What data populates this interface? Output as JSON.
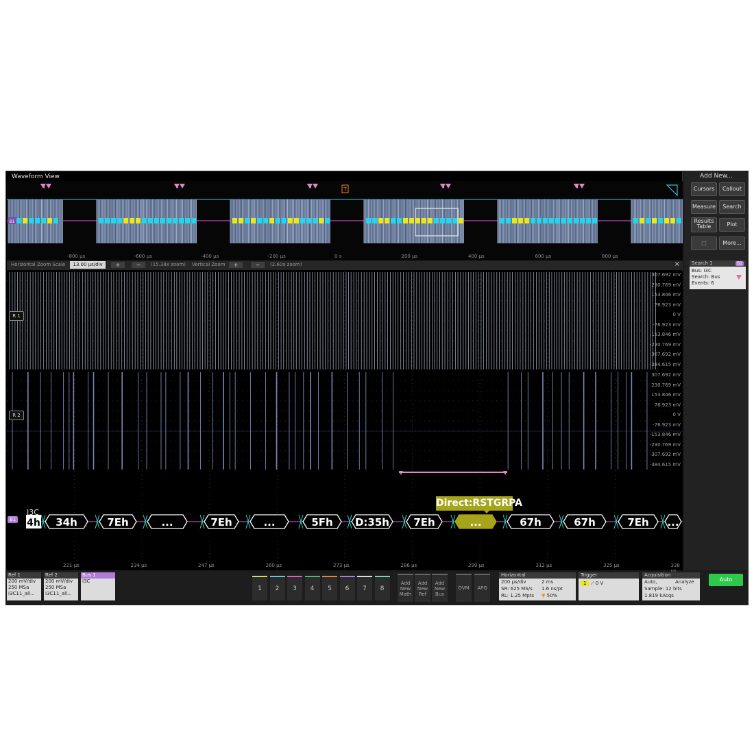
{
  "waveform_view": {
    "title": "Waveform View",
    "overview_ticks": [
      "-800 µs",
      "-600 µs",
      "-400 µs",
      "-200 µs",
      "0 s",
      "200 µs",
      "400 µs",
      "600 µs",
      "800 µs"
    ],
    "bus_marker": "B1",
    "trigger_marker": "T"
  },
  "zoom_bar": {
    "horizontal_label": "Horizontal Zoom Scale",
    "horizontal_value": "13.00 µs/div",
    "horizontal_zoom": "(15.38x zoom)",
    "vertical_label": "Vertical Zoom",
    "vertical_zoom": "(2.60x zoom)",
    "plus": "+",
    "minus": "−",
    "close": "×"
  },
  "ref1": {
    "label": "R 1",
    "yticks": [
      "307.692 mV",
      "230.769 mV",
      "153.846 mV",
      "76.923 mV",
      "0 V",
      "-76.923 mV",
      "-153.846 mV",
      "-230.769 mV",
      "-307.692 mV",
      "-384.615 mV"
    ]
  },
  "ref2": {
    "label": "R 2",
    "yticks": [
      "307.692 mV",
      "230.769 mV",
      "153.846 mV",
      "76.923 mV",
      "0 V",
      "-76.923 mV",
      "-153.846 mV",
      "-230.769 mV",
      "-307.692 mV",
      "-384.615 mV"
    ]
  },
  "bus": {
    "label": "B1",
    "protocol": "I3C",
    "partial": "4h",
    "packets": [
      "34h",
      "7Eh",
      "...",
      "7Eh",
      "...",
      "5Fh",
      "D:35h",
      "7Eh",
      "...",
      "67h",
      "67h",
      "7Eh",
      "..."
    ],
    "callout": "Direct:RSTGRPA",
    "time_ticks": [
      "221 µs",
      "234 µs",
      "247 µs",
      "260 µs",
      "273 µs",
      "286 µs",
      "299 µs",
      "312 µs",
      "325 µs",
      "338 µs"
    ]
  },
  "sidebar": {
    "title": "Add New...",
    "buttons": {
      "cursors": "Cursors",
      "callout": "Callout",
      "measure": "Measure",
      "search": "Search",
      "results_1": "Results",
      "results_2": "Table",
      "plot": "Plot",
      "more": "More..."
    },
    "search_card": {
      "title": "Search 1",
      "badge": "B1",
      "line1": "Bus: I3C",
      "line2": "Search: Bus",
      "line3": "Events: 6"
    }
  },
  "bottom": {
    "ref1": {
      "header": "Ref 1",
      "lines": [
        "200 mV/div",
        "250 MSa",
        "I3C11_all..."
      ]
    },
    "ref2": {
      "header": "Ref 2",
      "lines": [
        "200 mV/div",
        "250 MSa",
        "I3C11_all..."
      ]
    },
    "bus1": {
      "header": "Bus 1",
      "lines": [
        "I3C"
      ]
    },
    "channels": [
      "1",
      "2",
      "3",
      "4",
      "5",
      "6",
      "7",
      "8"
    ],
    "add_math": [
      "Add",
      "New",
      "Math"
    ],
    "add_ref": [
      "Add",
      "New",
      "Ref"
    ],
    "add_bus": [
      "Add",
      "New",
      "Bus"
    ],
    "dvm": "DVM",
    "afg": "AFG",
    "horizontal": {
      "header": "Horizontal",
      "l1a": "200 µs/div",
      "l1b": "2 ms",
      "l2a": "SR: 625 MS/s",
      "l2b": "1.6 ns/pt",
      "l3a": "RL: 1.25 Mpts",
      "l3b": "50%"
    },
    "trigger": {
      "header": "Trigger",
      "badge": "1",
      "value": "0 V"
    },
    "acquisition": {
      "header": "Acquisition",
      "l1a": "Auto,",
      "l1b": "Analyze",
      "l2": "Sample: 12 bits",
      "l3": "1.819 kAcqs"
    },
    "auto": "Auto"
  },
  "colors": {
    "bus_yellow": "#e8e81a",
    "bus_cyan": "#22d6ee",
    "bus_magenta": "#e060e0",
    "packet_green": "#2ad68a",
    "callout": "#a5a41a",
    "search_marker": "#e088c8",
    "trigger_orange": "#f08a1a",
    "auto_green": "#2ec84a",
    "ref_trace": "#b8c4dc"
  }
}
